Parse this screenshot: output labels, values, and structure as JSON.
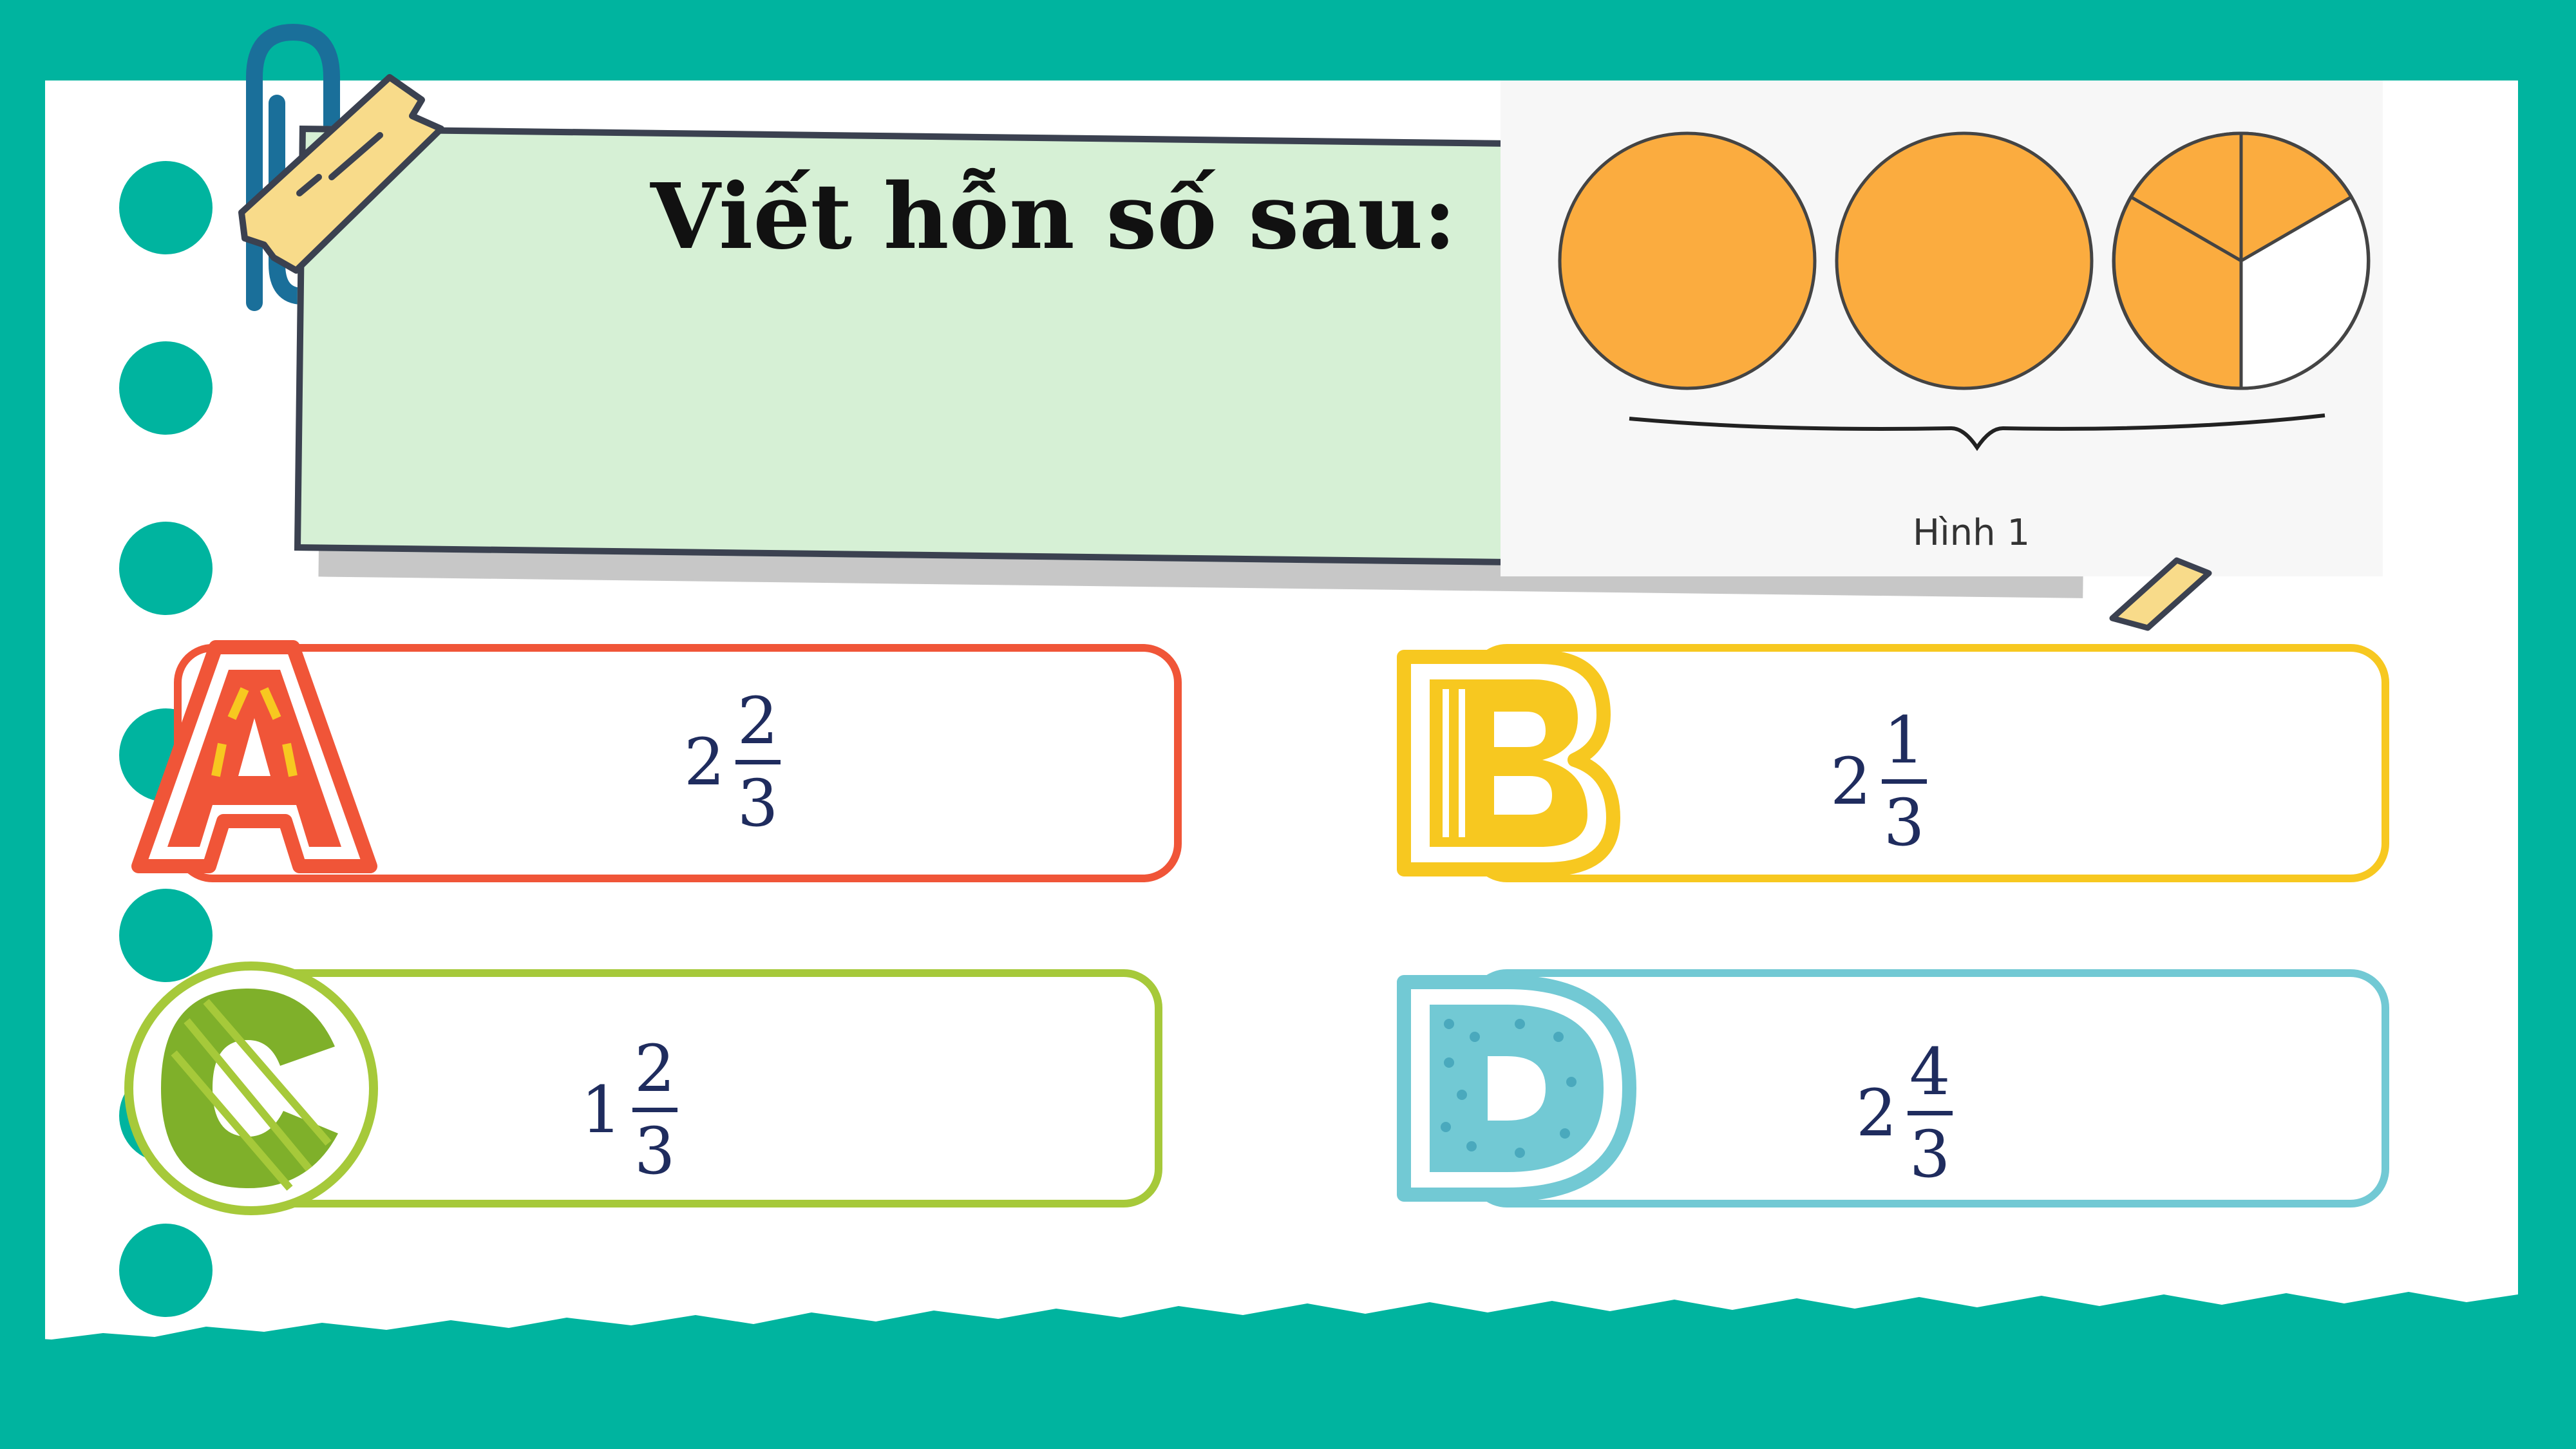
{
  "question": {
    "title": "Viết hỗn số sau:"
  },
  "figure": {
    "caption": "Hình 1",
    "whole_circles": 2,
    "partial_circle_shaded_thirds": 2,
    "shade_color": "#fbac3f"
  },
  "options": [
    {
      "letter": "A",
      "whole": "2",
      "numerator": "2",
      "denominator": "3",
      "color": "#f05538"
    },
    {
      "letter": "B",
      "whole": "2",
      "numerator": "1",
      "denominator": "3",
      "color": "#f7c820"
    },
    {
      "letter": "C",
      "whole": "1",
      "numerator": "2",
      "denominator": "3",
      "color": "#a6c93a"
    },
    {
      "letter": "D",
      "whole": "2",
      "numerator": "4",
      "denominator": "3",
      "color": "#72c9d4"
    }
  ],
  "colors": {
    "frame": "#00b49f",
    "header_bg": "#d6f0d5",
    "math_text": "#1f2c5e"
  }
}
